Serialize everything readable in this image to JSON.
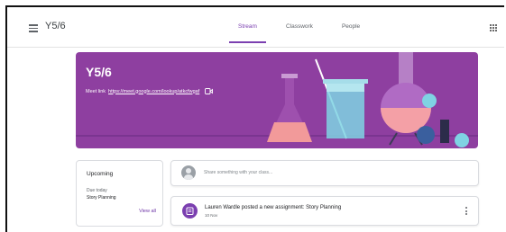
{
  "header": {
    "class_name": "Y5/6",
    "tabs": [
      {
        "label": "Stream",
        "active": true
      },
      {
        "label": "Classwork",
        "active": false
      },
      {
        "label": "People",
        "active": false
      }
    ],
    "menu_icon": "hamburger-menu-icon",
    "apps_icon": "google-apps-icon"
  },
  "banner": {
    "title": "Y5/6",
    "meet_label": "Meet link",
    "meet_url": "https://meet.google.com/lookup/atkcfwgaf",
    "background_color": "#8e3fa0",
    "video_icon": "video-camera-icon"
  },
  "upcoming": {
    "title": "Upcoming",
    "due": "Due today",
    "item": "Story Planning",
    "view_all": "View all"
  },
  "share": {
    "placeholder": "Share something with your class..."
  },
  "post": {
    "title": "Lauren Wardle posted a new assignment: Story Planning",
    "date": "10 Nov",
    "icon": "assignment-icon",
    "accent_color": "#7b3fb0"
  }
}
